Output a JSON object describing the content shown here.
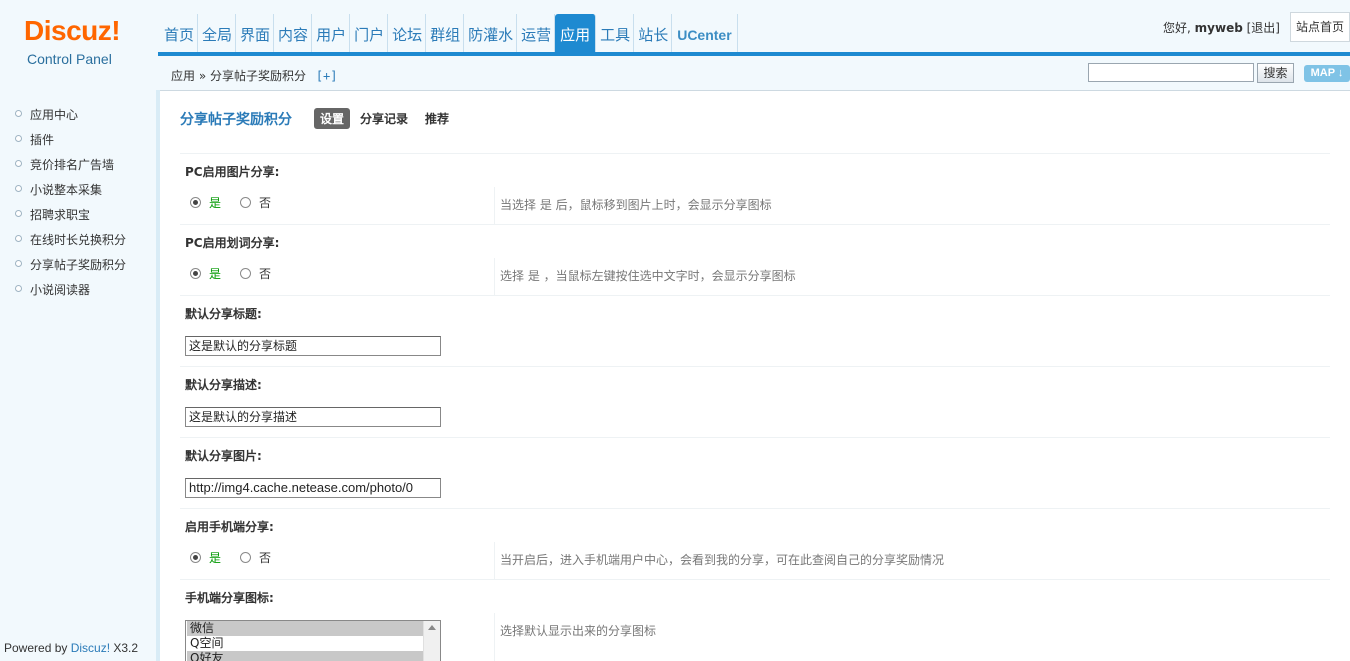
{
  "logo": {
    "brand": "Discuz!",
    "subtitle": "Control Panel"
  },
  "nav": [
    {
      "label": "首页",
      "active": false
    },
    {
      "label": "全局",
      "active": false
    },
    {
      "label": "界面",
      "active": false
    },
    {
      "label": "内容",
      "active": false
    },
    {
      "label": "用户",
      "active": false
    },
    {
      "label": "门户",
      "active": false
    },
    {
      "label": "论坛",
      "active": false
    },
    {
      "label": "群组",
      "active": false
    },
    {
      "label": "防灌水",
      "active": false
    },
    {
      "label": "运营",
      "active": false
    },
    {
      "label": "应用",
      "active": true
    },
    {
      "label": "工具",
      "active": false
    },
    {
      "label": "站长",
      "active": false
    },
    {
      "label": "UCenter",
      "active": false
    }
  ],
  "user": {
    "greeting": "您好,",
    "name": "myweb",
    "logout": "[退出]",
    "site_home": "站点首页"
  },
  "breadcrumb": {
    "path": "应用 » 分享帖子奖励积分",
    "add": "[+]"
  },
  "search": {
    "value": "",
    "button": "搜索",
    "map": "MAP"
  },
  "sidebar": {
    "items": [
      {
        "label": "应用中心"
      },
      {
        "label": "插件"
      },
      {
        "label": "竞价排名广告墙"
      },
      {
        "label": "小说整本采集"
      },
      {
        "label": "招聘求职宝"
      },
      {
        "label": "在线时长兑换积分"
      },
      {
        "label": "分享帖子奖励积分"
      },
      {
        "label": "小说阅读器"
      }
    ],
    "powered": {
      "prefix": "Powered by ",
      "brand": "Discuz!",
      "version": " X3.2"
    }
  },
  "main": {
    "title": "分享帖子奖励积分",
    "tabs": [
      {
        "label": "设置",
        "active": true
      },
      {
        "label": "分享记录",
        "active": false
      },
      {
        "label": "推荐",
        "active": false
      }
    ],
    "pc_image_share": {
      "label": "PC启用图片分享:",
      "yes": "是",
      "no": "否",
      "selected": "yes",
      "tip": "当选择 是 后，鼠标移到图片上时，会显示分享图标"
    },
    "pc_text_share": {
      "label": "PC启用划词分享:",
      "yes": "是",
      "no": "否",
      "selected": "yes",
      "tip": "选择 是 ，当鼠标左键按住选中文字时，会显示分享图标"
    },
    "default_title": {
      "label": "默认分享标题:",
      "value": "这是默认的分享标题"
    },
    "default_desc": {
      "label": "默认分享描述:",
      "value": "这是默认的分享描述"
    },
    "default_image": {
      "label": "默认分享图片:",
      "value": "http://img4.cache.netease.com/photo/0"
    },
    "mobile_share": {
      "label": "启用手机端分享:",
      "yes": "是",
      "no": "否",
      "selected": "yes",
      "tip": "当开启后，进入手机端用户中心，会看到我的分享，可在此查阅自己的分享奖励情况"
    },
    "mobile_icons": {
      "label": "手机端分享图标:",
      "options": [
        "微信",
        "Q空间",
        "Q好友"
      ],
      "selected": [
        0,
        2
      ],
      "tip": "选择默认显示出来的分享图标"
    }
  }
}
